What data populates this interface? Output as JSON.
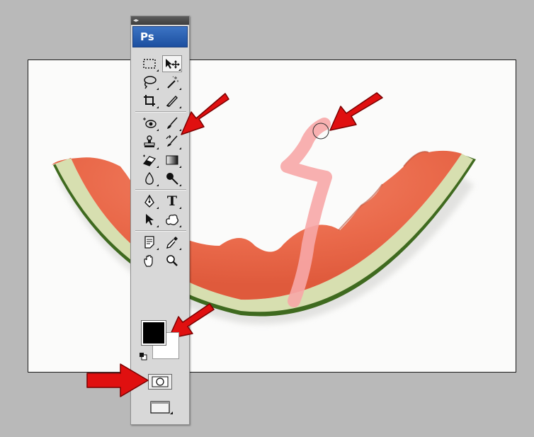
{
  "panel": {
    "grip_label": "◂▸",
    "logo_text": "Ps"
  },
  "tools": [
    {
      "name": "marquee-tool",
      "icon": "dashed-rect-icon",
      "selected": false
    },
    {
      "name": "move-tool",
      "icon": "move-arrow-icon",
      "selected": true
    },
    {
      "name": "lasso-tool",
      "icon": "lasso-icon"
    },
    {
      "name": "magic-wand-tool",
      "icon": "magic-wand-icon"
    },
    {
      "name": "crop-tool",
      "icon": "crop-icon"
    },
    {
      "name": "eyedropper-slice-tool",
      "icon": "slice-knife-icon"
    },
    {
      "name": "spot-healing-tool",
      "icon": "eye-patch-icon"
    },
    {
      "name": "brush-tool",
      "icon": "brush-icon"
    },
    {
      "name": "clone-stamp-tool",
      "icon": "stamp-icon"
    },
    {
      "name": "history-brush-tool",
      "icon": "history-brush-icon"
    },
    {
      "name": "eraser-tool",
      "icon": "eraser-icon"
    },
    {
      "name": "gradient-tool",
      "icon": "gradient-icon"
    },
    {
      "name": "blur-tool",
      "icon": "drop-icon"
    },
    {
      "name": "dodge-tool",
      "icon": "dodge-icon"
    },
    {
      "name": "pen-tool",
      "icon": "pen-nib-icon"
    },
    {
      "name": "type-tool",
      "icon": "type-icon",
      "label": "T"
    },
    {
      "name": "path-selection-tool",
      "icon": "arrow-select-icon"
    },
    {
      "name": "custom-shape-tool",
      "icon": "blob-shape-icon"
    },
    {
      "name": "notes-tool",
      "icon": "notes-icon"
    },
    {
      "name": "eyedropper-tool",
      "icon": "eyedropper-icon"
    },
    {
      "name": "hand-tool",
      "icon": "hand-icon"
    },
    {
      "name": "zoom-tool",
      "icon": "magnifier-icon"
    }
  ],
  "colors": {
    "foreground": "#000000",
    "background": "#ffffff",
    "arrow": "#e01010",
    "brush_stroke": "#f7a7a7"
  }
}
